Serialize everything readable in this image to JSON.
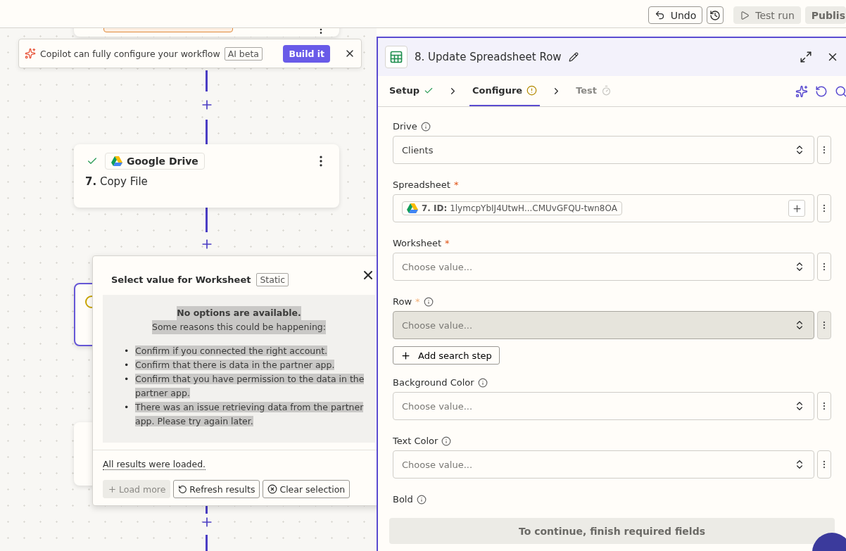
{
  "toolbar": {
    "buttons": [
      {
        "kind": "undo",
        "label": "Undo"
      },
      {
        "kind": "history"
      },
      {
        "kind": "test",
        "label": "Test run"
      },
      {
        "kind": "publish",
        "label": "Publis"
      }
    ]
  },
  "copilot_banner": {
    "text": "Copilot can fully configure your workflow",
    "badge": "AI beta",
    "button": "Build it"
  },
  "nodes": [
    {
      "kind": "cut_top"
    },
    {
      "kind": "step",
      "done": true,
      "app": "Google Drive",
      "number": "7.",
      "title": "Copy File"
    },
    {
      "kind": "cut_side",
      "selected": true
    },
    {
      "kind": "cut_side",
      "selected": false
    }
  ],
  "popover": {
    "title": "Select value for Worksheet",
    "badge": "Static",
    "messages": [
      {
        "kind": "heading",
        "text": "No options are available.",
        "highlighted": true
      },
      {
        "kind": "body",
        "text": "Some reasons this could be happening:",
        "highlighted": true
      }
    ],
    "reasons": [
      {
        "bullet": "•",
        "text": "Confirm if you connected the right account.",
        "highlighted": true
      },
      {
        "bullet": "•",
        "text": "Confirm that there is data in the partner app.",
        "highlighted": true
      },
      {
        "bullet": "•",
        "text": "Confirm that you have permission to the data in the partner app.",
        "highlighted": true
      },
      {
        "bullet": "•",
        "text": "There was an issue retrieving data from the partner app. Please try again later.",
        "highlighted": true
      }
    ],
    "footer_note": "All results were loaded.",
    "buttons": [
      {
        "kind": "load",
        "label": "Load more",
        "disabled": true
      },
      {
        "kind": "refresh",
        "label": "Refresh results",
        "disabled": false
      },
      {
        "kind": "clear",
        "label": "Clear selection",
        "disabled": false
      }
    ]
  },
  "panel": {
    "title": "8. Update Spreadsheet Row",
    "steps": [
      {
        "label": "Setup",
        "kind": "done",
        "selected": false
      },
      {
        "label": "Configure",
        "kind": "warning",
        "selected": true
      },
      {
        "label": "Test",
        "kind": "pending",
        "selected": false
      }
    ],
    "fields": [
      {
        "kind": "select",
        "label": "Drive",
        "info": true,
        "value": "Clients",
        "active": false
      },
      {
        "kind": "chip",
        "label": "Spreadsheet",
        "required_mark": "*",
        "info": false,
        "value": "**7. ID:** 1lymcpYbIJ4UtwH...CMUvGFQU-twn8OA",
        "active": false
      },
      {
        "kind": "select",
        "label": "Worksheet",
        "required_mark": "*",
        "info": false,
        "placeholder": "Choose value...",
        "active": false
      },
      {
        "kind": "select",
        "label": "Row",
        "required_mark": "*",
        "info": true,
        "placeholder": "Choose value...",
        "active": true,
        "extra_button": "Add search step"
      },
      {
        "kind": "select",
        "label": "Background Color",
        "info": true,
        "placeholder": "Choose value...",
        "active": false
      },
      {
        "kind": "select",
        "label": "Text Color",
        "info": true,
        "placeholder": "Choose value...",
        "active": false
      },
      {
        "kind": "label_only",
        "label": "Bold",
        "info": true
      }
    ],
    "continue_button": "To continue, finish required fields"
  }
}
